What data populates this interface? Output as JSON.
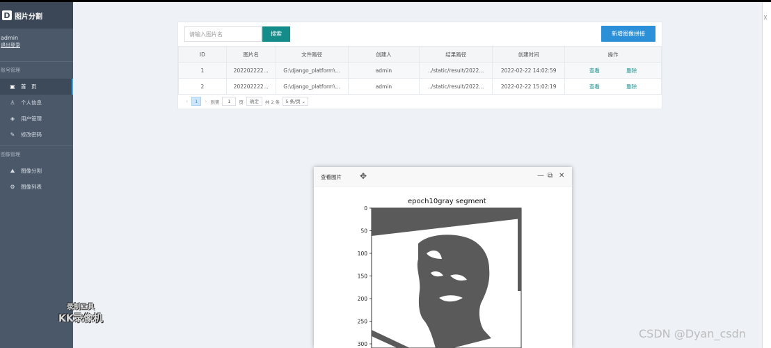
{
  "sidebar": {
    "logo_letter": "D",
    "app_title": "图片分割",
    "user": "admin",
    "logout": "退出登录",
    "sections": [
      {
        "title": "账号管理",
        "items": [
          {
            "label": "首　页",
            "icon": "dashboard-icon",
            "glyph": "▣"
          },
          {
            "label": "个人信息",
            "icon": "user-icon",
            "glyph": "♙"
          },
          {
            "label": "用户管理",
            "icon": "layers-icon",
            "glyph": "◈"
          },
          {
            "label": "修改密码",
            "icon": "pen-icon",
            "glyph": "✎"
          }
        ]
      },
      {
        "title": "图像管理",
        "items": [
          {
            "label": "图像分割",
            "icon": "image-seg-icon",
            "glyph": "⛰"
          },
          {
            "label": "图像列表",
            "icon": "gear-icon",
            "glyph": "⚙"
          }
        ]
      }
    ]
  },
  "toolbar": {
    "search_placeholder": "请输入图片名",
    "search_label": "搜索",
    "add_label": "新增图像拼接"
  },
  "table": {
    "headers": [
      "ID",
      "图片名",
      "文件路径",
      "创建人",
      "结果路径",
      "创建时间",
      "操作"
    ],
    "rows": [
      {
        "id": "1",
        "name": "202202222...",
        "path": "G:\\django_platform\\...",
        "creator": "admin",
        "result": "../static/result/2022...",
        "time": "2022-02-22 14:02:59",
        "view": "查看",
        "del": "删除"
      },
      {
        "id": "2",
        "name": "202202222...",
        "path": "G:\\django_platform\\...",
        "creator": "admin",
        "result": "../static/result/2022...",
        "time": "2022-02-22 15:02:19",
        "view": "查看",
        "del": "删除"
      }
    ]
  },
  "pager": {
    "prev": "‹",
    "current_page": "1",
    "next": "›",
    "goto_label": "到第",
    "goto_value": "1",
    "page_unit": "页",
    "confirm": "确定",
    "total": "共 2 条",
    "page_size": "5 条/页"
  },
  "dialog": {
    "title": "查看图片",
    "plot": {
      "title": "epoch10gray segment",
      "y_ticks": [
        "0",
        "50",
        "100",
        "150",
        "200",
        "250",
        "300"
      ]
    }
  },
  "watermarks": {
    "kk_line1": "录制工具",
    "kk_line2": "KK录像机",
    "csdn": "CSDN @Dyan_csdn"
  },
  "colors": {
    "sidebar": "#4a5869",
    "accent_teal": "#148c8a",
    "accent_blue": "#2c90d8"
  }
}
